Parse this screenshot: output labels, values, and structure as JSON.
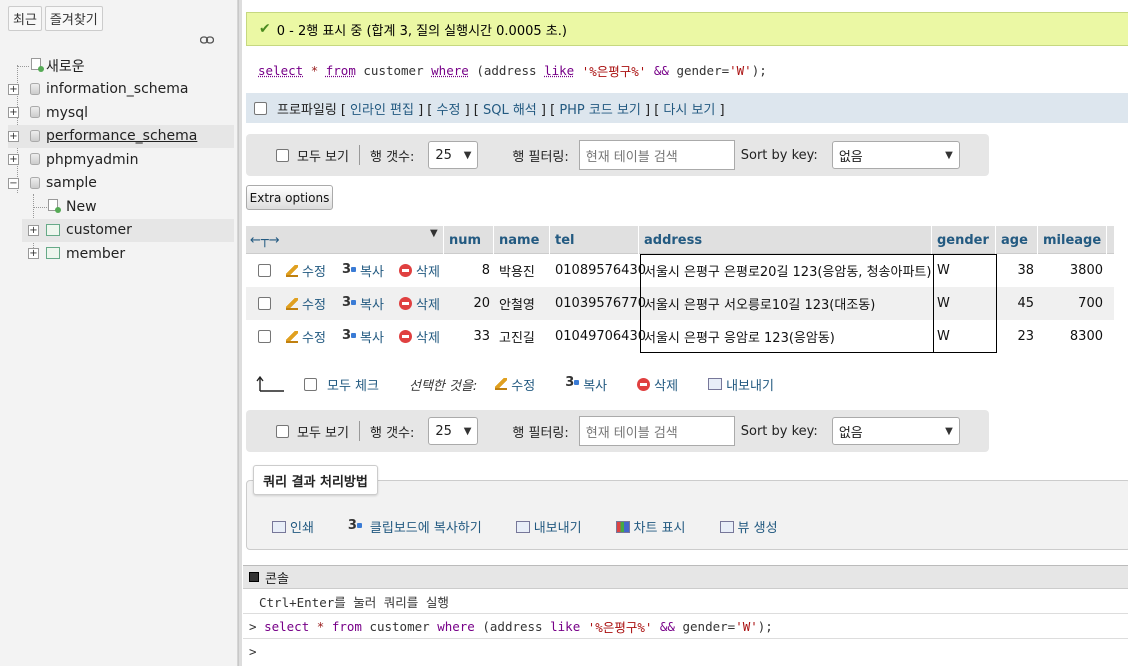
{
  "sidebar": {
    "tabs": [
      "최근",
      "즐겨찾기"
    ],
    "tree": [
      {
        "label": "새로운",
        "type": "new"
      },
      {
        "label": "information_schema",
        "type": "db"
      },
      {
        "label": "mysql",
        "type": "db"
      },
      {
        "label": "performance_schema",
        "type": "db"
      },
      {
        "label": "phpmyadmin",
        "type": "db"
      },
      {
        "label": "sample",
        "type": "db"
      },
      {
        "label": "New",
        "type": "new"
      },
      {
        "label": "customer",
        "type": "table"
      },
      {
        "label": "member",
        "type": "table"
      }
    ]
  },
  "success_message": "0 - 2행 표시 중 (합계 3, 질의 실행시간 0.0005 초.)",
  "sql": {
    "select": "select",
    "star": "*",
    "from": "from",
    "table": "customer",
    "where": "where",
    "paren_open": "(",
    "col1": "address",
    "like": "like",
    "pattern": "'%은평구%'",
    "and_op": "&&",
    "col2": "gender=",
    "value": "'W'",
    "tail": ");"
  },
  "profiling": {
    "label": "프로파일링",
    "links": [
      "인라인 편집",
      "수정",
      "SQL 해석",
      "PHP 코드 보기",
      "다시 보기"
    ]
  },
  "nav": {
    "show_all": "모두 보기",
    "rows_label": "행 갯수:",
    "rows_value": "25",
    "filter_label": "행 필터링:",
    "filter_placeholder": "현재 테이블 검색",
    "sort_label": "Sort by key:",
    "sort_value": "없음"
  },
  "extra_options": "Extra options",
  "table": {
    "columns": [
      "num",
      "name",
      "tel",
      "address",
      "gender",
      "age",
      "mileage"
    ],
    "actions": {
      "edit": "수정",
      "copy": "복사",
      "delete": "삭제"
    },
    "rows": [
      {
        "num": "8",
        "name": "박용진",
        "tel": "01089576430",
        "address": "서울시 은평구  은평로20길 123(응암동, 청송아파트)",
        "gender": "W",
        "age": "38",
        "mileage": "3800"
      },
      {
        "num": "20",
        "name": "안철영",
        "tel": "01039576770",
        "address": "서울시 은평구 서오릉로10길 123(대조동)",
        "gender": "W",
        "age": "45",
        "mileage": "700"
      },
      {
        "num": "33",
        "name": "고진길",
        "tel": "01049706430",
        "address": "서울시 은평구 응암로 123(응암동)",
        "gender": "W",
        "age": "23",
        "mileage": "8300"
      }
    ]
  },
  "bulk": {
    "check_all": "모두 체크",
    "selected": "선택한 것을:",
    "edit": "수정",
    "copy": "복사",
    "delete": "삭제",
    "export": "내보내기"
  },
  "query_ops": {
    "legend": "쿼리 결과 처리방법",
    "links": [
      "인쇄",
      "클립보드에 복사하기",
      "내보내기",
      "차트 표시",
      "뷰 생성"
    ]
  },
  "console": {
    "title": "콘솔",
    "hint": "Ctrl+Enter를 눌러 쿼리를 실행",
    "prompt": ">"
  }
}
